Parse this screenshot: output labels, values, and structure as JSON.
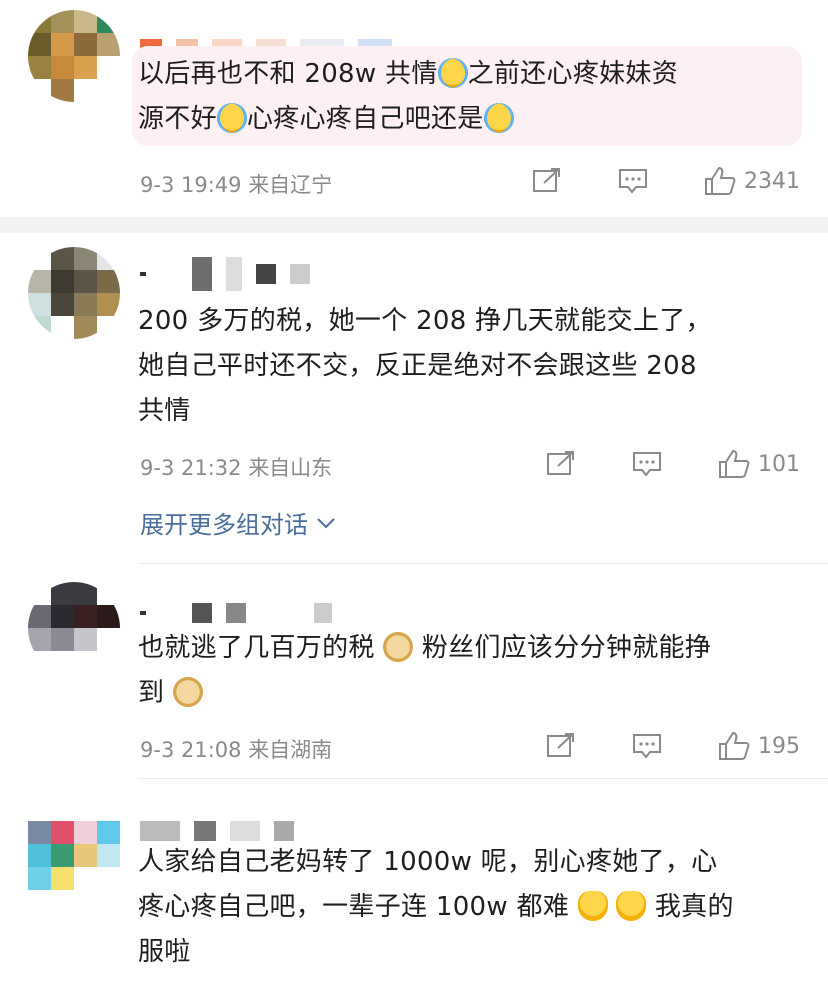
{
  "comments": [
    {
      "text_line1": "以后再也不和 208w 共情",
      "text_line1b": "之前还心疼妹妹资",
      "text_line2a": "源不好",
      "text_line2b": "心疼心疼自己吧还是",
      "time": "9-3 19:49",
      "location": "来自辽宁",
      "likes": "2341",
      "emojis": [
        "crying-emoji",
        "crying-emoji",
        "crying-emoji"
      ]
    },
    {
      "text_line1": "200 多万的税，她一个 208 挣几天就能交上了，",
      "text_line2": "她自己平时还不交，反正是绝对不会跟这些 208",
      "text_line3": "共情",
      "time": "9-3 21:32",
      "location": "来自山东",
      "likes": "101",
      "expand_label": "展开更多组对话"
    },
    {
      "text_line1a": "也就逃了几百万的税",
      "text_line1b": "粉丝们应该分分钟就能挣",
      "text_line2": "到",
      "time": "9-3 21:08",
      "location": "来自湖南",
      "likes": "195",
      "emojis": [
        "doge-emoji",
        "doge-emoji"
      ]
    },
    {
      "text_line1": "人家给自己老妈转了 1000w 呢，别心疼她了，心",
      "text_line2a": "疼心疼自己吧，一辈子连 100w 都难",
      "text_line2b": "我真的",
      "text_line3": "服啦",
      "emojis": [
        "sweat-emoji",
        "sweat-emoji"
      ]
    }
  ],
  "colors": {
    "link_blue": "#4a6e9c",
    "meta_gray": "#8a8a8a",
    "highlight_pink": "#fdf0f2"
  }
}
